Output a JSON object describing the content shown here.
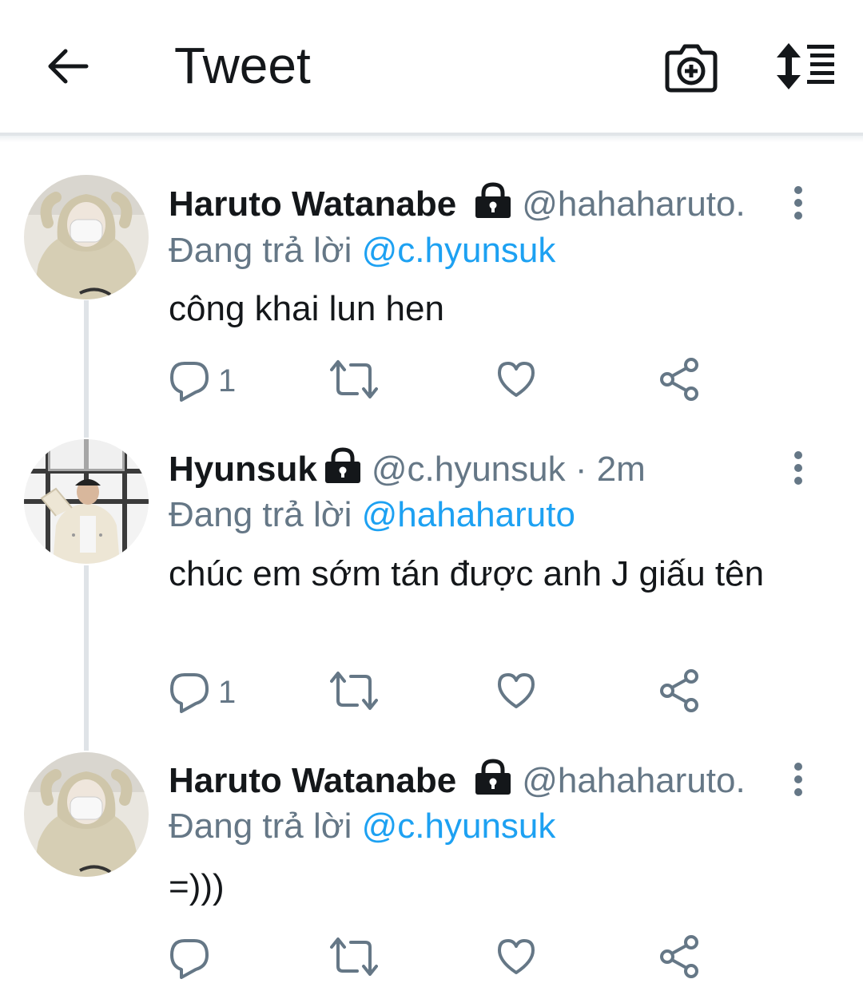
{
  "header": {
    "title": "Tweet",
    "icons": [
      "back-arrow-icon",
      "camera-plus-icon",
      "sort-lines-icon"
    ]
  },
  "tweets": [
    {
      "name": "Haruto Watanabe",
      "handle": "@hahaharuto.",
      "reply_prefix": "Đang trả lời",
      "reply_to": "@c.hyunsuk",
      "text": "công khai lun hen",
      "reply_count": "1",
      "locked": true
    },
    {
      "name": "Hyunsuk",
      "handle": "@c.hyunsuk · 2m",
      "reply_prefix": "Đang trả lời",
      "reply_to": "@hahaharuto",
      "text": "chúc em sớm tán được anh J giấu tên",
      "reply_count": "1",
      "locked": true
    },
    {
      "name": "Haruto Watanabe",
      "handle": "@hahaharuto.",
      "reply_prefix": "Đang trả lời",
      "reply_to": "@c.hyunsuk",
      "text": "=)))",
      "reply_count": "",
      "locked": true
    }
  ],
  "colors": {
    "text": "#14171a",
    "secondary": "#657786",
    "mention": "#1da1f2",
    "thread_line": "#dfe3e7"
  }
}
